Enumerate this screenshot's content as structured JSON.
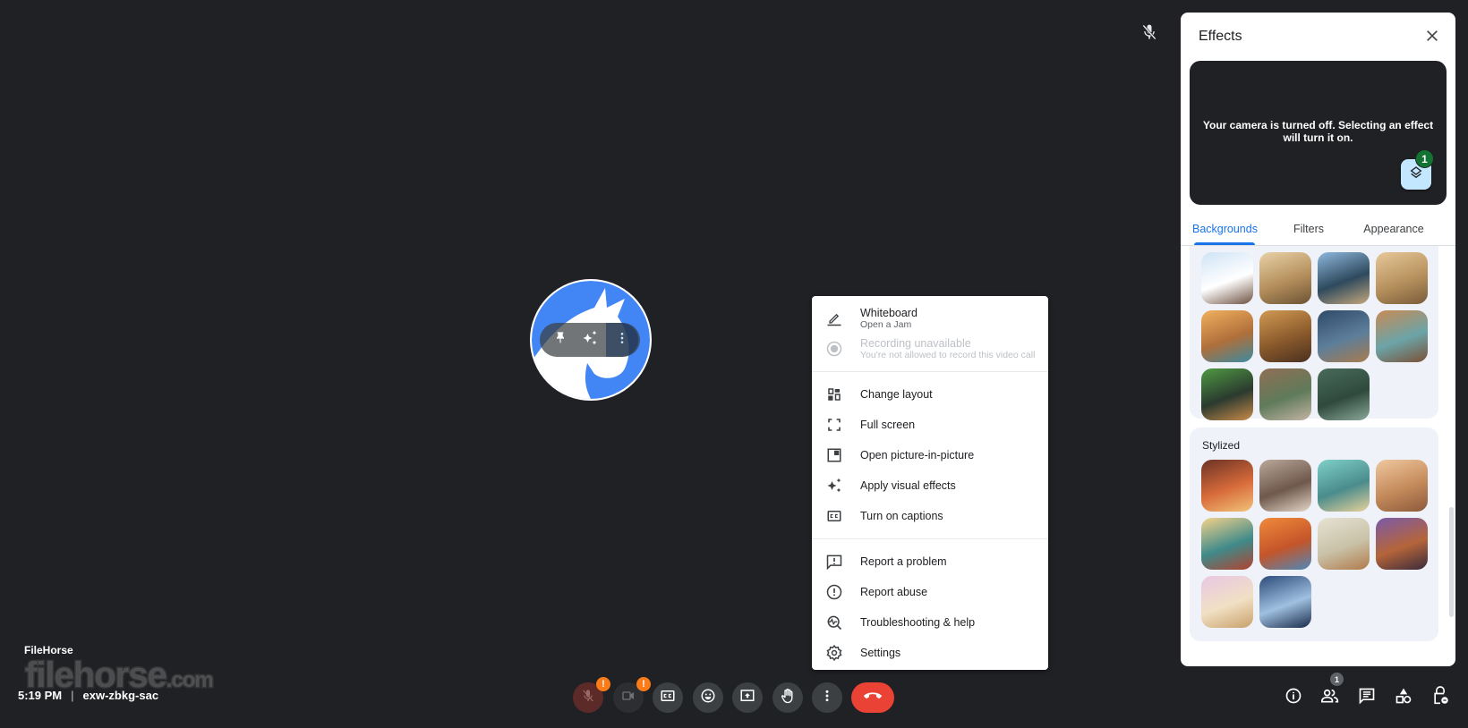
{
  "meeting": {
    "time": "5:19 PM",
    "divider": "|",
    "code": "exw-zbkg-sac",
    "self_name": "FileHorse",
    "watermark": "filehorse",
    "watermark_suffix": ".com"
  },
  "top_indicator": {
    "icon": "mic-off-icon"
  },
  "tile": {
    "avatar_colors": {
      "background": "#4285f4",
      "figure": "#ffffff"
    },
    "controls": [
      {
        "name": "pin",
        "icon": "pin-icon"
      },
      {
        "name": "effects",
        "icon": "sparkle-icon"
      },
      {
        "name": "more",
        "icon": "more-vert-icon"
      }
    ]
  },
  "more_menu": {
    "items": [
      {
        "label": "Whiteboard",
        "sublabel": "Open a Jam",
        "icon": "pencil-icon",
        "disabled": false
      },
      {
        "label": "Recording unavailable",
        "sublabel": "You're not allowed to record this video call",
        "icon": "record-icon",
        "disabled": true
      },
      {
        "label": "Change layout",
        "icon": "layout-icon"
      },
      {
        "label": "Full screen",
        "icon": "fullscreen-icon"
      },
      {
        "label": "Open picture-in-picture",
        "icon": "pip-icon"
      },
      {
        "label": "Apply visual effects",
        "icon": "sparkle-icon"
      },
      {
        "label": "Turn on captions",
        "icon": "captions-icon"
      },
      {
        "label": "Report a problem",
        "icon": "feedback-icon"
      },
      {
        "label": "Report abuse",
        "icon": "report-icon"
      },
      {
        "label": "Troubleshooting & help",
        "icon": "troubleshoot-icon"
      },
      {
        "label": "Settings",
        "icon": "gear-icon"
      }
    ]
  },
  "effects_panel": {
    "title": "Effects",
    "close_icon": "close-icon",
    "preview_message": "Your camera is turned off. Selecting an effect will turn it on.",
    "layers_badge": "1",
    "tabs": [
      {
        "label": "Backgrounds",
        "active": true
      },
      {
        "label": "Filters",
        "active": false
      },
      {
        "label": "Appearance",
        "active": false
      }
    ],
    "backgrounds_group": {
      "partial_row": [
        "#8a6a4a",
        "#5b5650",
        "#9a7f6d",
        "#2a2a2a"
      ],
      "thumbs": [
        {
          "name": "modern-balcony",
          "colors": [
            "#cfe3f5",
            "#ffffff",
            "#6e5040"
          ]
        },
        {
          "name": "golden-lake",
          "colors": [
            "#e8d2a8",
            "#b58f5c",
            "#6b5234"
          ]
        },
        {
          "name": "beach-arch",
          "colors": [
            "#8fb8de",
            "#2e4a5e",
            "#c4a77c"
          ]
        },
        {
          "name": "desert-sunset",
          "colors": [
            "#e7c89a",
            "#b7925e",
            "#7a5c3a"
          ]
        },
        {
          "name": "pool-palms",
          "colors": [
            "#f0b15f",
            "#b06f3a",
            "#3c8aa0"
          ]
        },
        {
          "name": "safari-porch",
          "colors": [
            "#d19a53",
            "#8a5a2b",
            "#4a3020"
          ]
        },
        {
          "name": "storm-cabin",
          "colors": [
            "#2f4a6a",
            "#5d7e9a",
            "#a87b4d"
          ]
        },
        {
          "name": "colonial-street",
          "colors": [
            "#c98a55",
            "#6ba4a8",
            "#7b5035"
          ]
        },
        {
          "name": "night-plaza",
          "colors": [
            "#4f9a43",
            "#2b3a2f",
            "#c98b4a"
          ]
        },
        {
          "name": "greenhouse-warm",
          "colors": [
            "#8f6e55",
            "#5f7b5a",
            "#c4b4a4"
          ]
        },
        {
          "name": "greenhouse-cool",
          "colors": [
            "#496b5b",
            "#2f4a3d",
            "#8aa89a"
          ]
        }
      ]
    },
    "stylized_group": {
      "title": "Stylized",
      "thumbs": [
        {
          "name": "cozy-fireplace",
          "colors": [
            "#6b3226",
            "#d86b3a",
            "#f1c37a"
          ]
        },
        {
          "name": "living-room",
          "colors": [
            "#b9a89a",
            "#6f584c",
            "#e3d6c8"
          ]
        },
        {
          "name": "underwater-ship",
          "colors": [
            "#7fd0c8",
            "#4a8c8c",
            "#e8d19a"
          ]
        },
        {
          "name": "paris-window",
          "colors": [
            "#f0c8a0",
            "#c48a5a",
            "#8b5a3c"
          ]
        },
        {
          "name": "retro-diner",
          "colors": [
            "#f4d28a",
            "#3f8a8a",
            "#b3422f"
          ]
        },
        {
          "name": "orange-kitchen",
          "colors": [
            "#f08a3a",
            "#c4552a",
            "#4d88b8"
          ]
        },
        {
          "name": "minimal-shelf",
          "colors": [
            "#e6e2d2",
            "#c9c2a8",
            "#b07a4a"
          ]
        },
        {
          "name": "festival-lights",
          "colors": [
            "#7a5aa8",
            "#b5653a",
            "#3a2a3a"
          ]
        },
        {
          "name": "dreamy-meadow",
          "colors": [
            "#e9c7e4",
            "#f1e0c4",
            "#c8a06a"
          ]
        },
        {
          "name": "car-interior",
          "colors": [
            "#2c4a7a",
            "#9fc0e0",
            "#1a2a4a"
          ]
        }
      ]
    }
  },
  "controls": {
    "mic": {
      "icon": "mic-off-icon",
      "warning": "!"
    },
    "camera": {
      "icon": "camera-off-icon",
      "warning": "!"
    },
    "captions": {
      "icon": "captions-icon"
    },
    "reactions": {
      "icon": "emoji-icon"
    },
    "present": {
      "icon": "present-icon"
    },
    "raise_hand": {
      "icon": "hand-icon"
    },
    "more": {
      "icon": "more-vert-icon"
    },
    "end_call": {
      "icon": "end-call-icon",
      "color": "#ea4335"
    }
  },
  "right_controls": {
    "info": {
      "icon": "info-icon"
    },
    "people": {
      "icon": "people-icon",
      "badge": "1"
    },
    "chat": {
      "icon": "chat-icon"
    },
    "activities": {
      "icon": "activities-icon"
    },
    "host_controls": {
      "icon": "lock-person-icon"
    }
  }
}
